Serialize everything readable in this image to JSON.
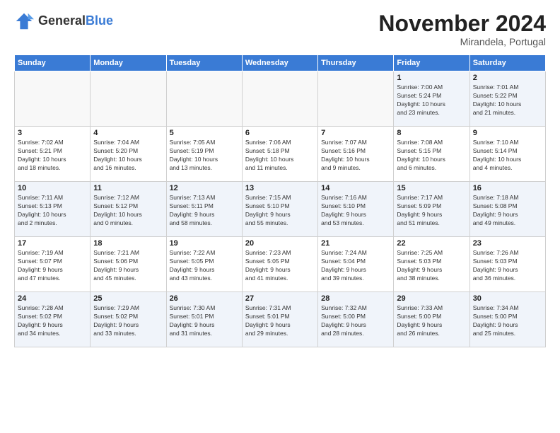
{
  "logo": {
    "general": "General",
    "blue": "Blue"
  },
  "header": {
    "month_title": "November 2024",
    "location": "Mirandela, Portugal"
  },
  "weekdays": [
    "Sunday",
    "Monday",
    "Tuesday",
    "Wednesday",
    "Thursday",
    "Friday",
    "Saturday"
  ],
  "weeks": [
    [
      {
        "day": "",
        "info": ""
      },
      {
        "day": "",
        "info": ""
      },
      {
        "day": "",
        "info": ""
      },
      {
        "day": "",
        "info": ""
      },
      {
        "day": "",
        "info": ""
      },
      {
        "day": "1",
        "info": "Sunrise: 7:00 AM\nSunset: 5:24 PM\nDaylight: 10 hours\nand 23 minutes."
      },
      {
        "day": "2",
        "info": "Sunrise: 7:01 AM\nSunset: 5:22 PM\nDaylight: 10 hours\nand 21 minutes."
      }
    ],
    [
      {
        "day": "3",
        "info": "Sunrise: 7:02 AM\nSunset: 5:21 PM\nDaylight: 10 hours\nand 18 minutes."
      },
      {
        "day": "4",
        "info": "Sunrise: 7:04 AM\nSunset: 5:20 PM\nDaylight: 10 hours\nand 16 minutes."
      },
      {
        "day": "5",
        "info": "Sunrise: 7:05 AM\nSunset: 5:19 PM\nDaylight: 10 hours\nand 13 minutes."
      },
      {
        "day": "6",
        "info": "Sunrise: 7:06 AM\nSunset: 5:18 PM\nDaylight: 10 hours\nand 11 minutes."
      },
      {
        "day": "7",
        "info": "Sunrise: 7:07 AM\nSunset: 5:16 PM\nDaylight: 10 hours\nand 9 minutes."
      },
      {
        "day": "8",
        "info": "Sunrise: 7:08 AM\nSunset: 5:15 PM\nDaylight: 10 hours\nand 6 minutes."
      },
      {
        "day": "9",
        "info": "Sunrise: 7:10 AM\nSunset: 5:14 PM\nDaylight: 10 hours\nand 4 minutes."
      }
    ],
    [
      {
        "day": "10",
        "info": "Sunrise: 7:11 AM\nSunset: 5:13 PM\nDaylight: 10 hours\nand 2 minutes."
      },
      {
        "day": "11",
        "info": "Sunrise: 7:12 AM\nSunset: 5:12 PM\nDaylight: 10 hours\nand 0 minutes."
      },
      {
        "day": "12",
        "info": "Sunrise: 7:13 AM\nSunset: 5:11 PM\nDaylight: 9 hours\nand 58 minutes."
      },
      {
        "day": "13",
        "info": "Sunrise: 7:15 AM\nSunset: 5:10 PM\nDaylight: 9 hours\nand 55 minutes."
      },
      {
        "day": "14",
        "info": "Sunrise: 7:16 AM\nSunset: 5:10 PM\nDaylight: 9 hours\nand 53 minutes."
      },
      {
        "day": "15",
        "info": "Sunrise: 7:17 AM\nSunset: 5:09 PM\nDaylight: 9 hours\nand 51 minutes."
      },
      {
        "day": "16",
        "info": "Sunrise: 7:18 AM\nSunset: 5:08 PM\nDaylight: 9 hours\nand 49 minutes."
      }
    ],
    [
      {
        "day": "17",
        "info": "Sunrise: 7:19 AM\nSunset: 5:07 PM\nDaylight: 9 hours\nand 47 minutes."
      },
      {
        "day": "18",
        "info": "Sunrise: 7:21 AM\nSunset: 5:06 PM\nDaylight: 9 hours\nand 45 minutes."
      },
      {
        "day": "19",
        "info": "Sunrise: 7:22 AM\nSunset: 5:05 PM\nDaylight: 9 hours\nand 43 minutes."
      },
      {
        "day": "20",
        "info": "Sunrise: 7:23 AM\nSunset: 5:05 PM\nDaylight: 9 hours\nand 41 minutes."
      },
      {
        "day": "21",
        "info": "Sunrise: 7:24 AM\nSunset: 5:04 PM\nDaylight: 9 hours\nand 39 minutes."
      },
      {
        "day": "22",
        "info": "Sunrise: 7:25 AM\nSunset: 5:03 PM\nDaylight: 9 hours\nand 38 minutes."
      },
      {
        "day": "23",
        "info": "Sunrise: 7:26 AM\nSunset: 5:03 PM\nDaylight: 9 hours\nand 36 minutes."
      }
    ],
    [
      {
        "day": "24",
        "info": "Sunrise: 7:28 AM\nSunset: 5:02 PM\nDaylight: 9 hours\nand 34 minutes."
      },
      {
        "day": "25",
        "info": "Sunrise: 7:29 AM\nSunset: 5:02 PM\nDaylight: 9 hours\nand 33 minutes."
      },
      {
        "day": "26",
        "info": "Sunrise: 7:30 AM\nSunset: 5:01 PM\nDaylight: 9 hours\nand 31 minutes."
      },
      {
        "day": "27",
        "info": "Sunrise: 7:31 AM\nSunset: 5:01 PM\nDaylight: 9 hours\nand 29 minutes."
      },
      {
        "day": "28",
        "info": "Sunrise: 7:32 AM\nSunset: 5:00 PM\nDaylight: 9 hours\nand 28 minutes."
      },
      {
        "day": "29",
        "info": "Sunrise: 7:33 AM\nSunset: 5:00 PM\nDaylight: 9 hours\nand 26 minutes."
      },
      {
        "day": "30",
        "info": "Sunrise: 7:34 AM\nSunset: 5:00 PM\nDaylight: 9 hours\nand 25 minutes."
      }
    ]
  ],
  "colors": {
    "header_bg": "#3a7bd5",
    "alt_row_bg": "#f0f4fa",
    "empty_bg": "#f8f8f8"
  }
}
